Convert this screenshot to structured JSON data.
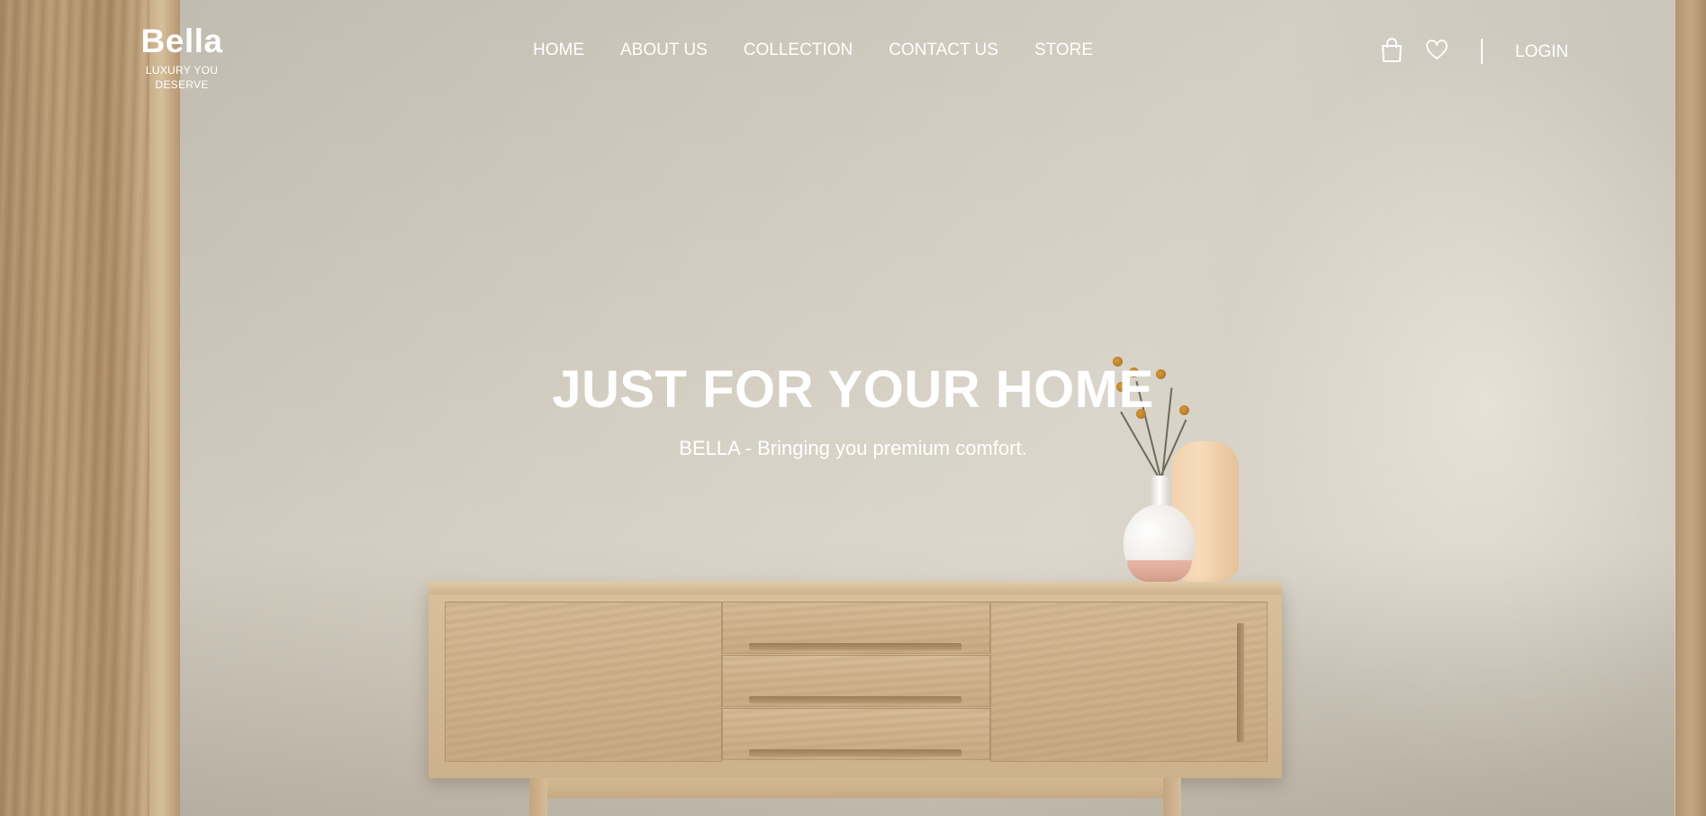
{
  "header": {
    "brand_name": "Bella",
    "brand_tagline": "LUXURY YOU DESERVE",
    "nav": [
      {
        "label": "HOME"
      },
      {
        "label": "ABOUT US"
      },
      {
        "label": "COLLECTION"
      },
      {
        "label": "CONTACT US"
      },
      {
        "label": "STORE"
      }
    ],
    "icons": [
      "shopping-bag-icon",
      "heart-icon"
    ],
    "login_label": "LOGIN"
  },
  "hero": {
    "title": "JUST FOR YOUR HOME",
    "subtitle": "BELLA - Bringing you premium comfort."
  },
  "colors": {
    "text": "#ffffff",
    "wall": "#d3cdc1",
    "wood": "#d6bb96"
  }
}
